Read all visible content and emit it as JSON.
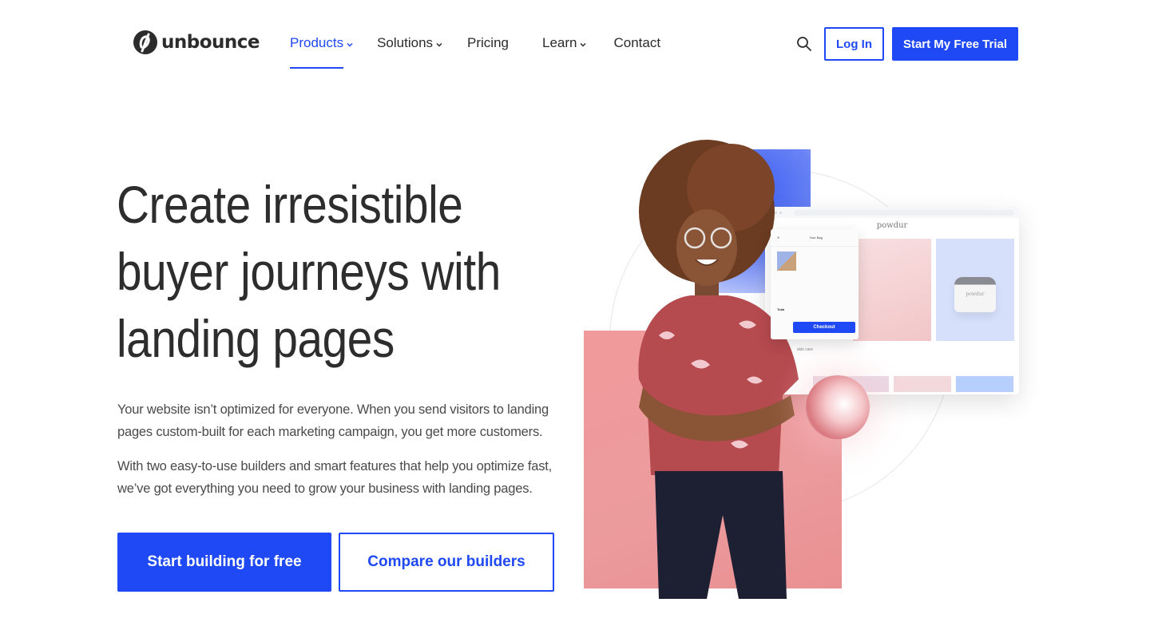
{
  "header": {
    "brand": "unbounce",
    "nav": [
      {
        "label": "Products",
        "has_dropdown": true,
        "active": true
      },
      {
        "label": "Solutions",
        "has_dropdown": true,
        "active": false
      },
      {
        "label": "Pricing",
        "has_dropdown": false,
        "active": false
      },
      {
        "label": "Learn",
        "has_dropdown": true,
        "active": false
      },
      {
        "label": "Contact",
        "has_dropdown": false,
        "active": false
      }
    ],
    "search_icon": "search-icon",
    "login_label": "Log In",
    "trial_label": "Start My Free Trial"
  },
  "hero": {
    "headline_lines": [
      "Create irresistible",
      "buyer journeys with",
      "landing pages"
    ],
    "paragraphs": [
      "Your website isn’t optimized for everyone. When you send visitors to landing pages custom-built for each marketing campaign, you get more customers.",
      "With two easy-to-use builders and smart features that help you optimize fast, we’ve got everything you need to grow your business with landing pages."
    ],
    "primary_cta": "Start building for free",
    "secondary_cta": "Compare our builders"
  },
  "illustration": {
    "mock_brand": "powdur",
    "mock_jar_label": "powdur",
    "mock_caption": "skin care",
    "cart_title": "Your Bag",
    "cart_total_label": "Total",
    "checkout_label": "Checkout"
  },
  "colors": {
    "accent": "#1f49f4",
    "text": "#2d2d2d",
    "body_text": "#4a4a4a",
    "pink_block": "#ec9b9d"
  }
}
